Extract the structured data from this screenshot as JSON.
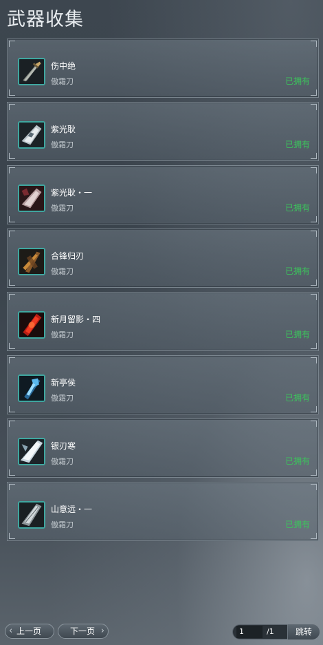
{
  "title": "武器收集",
  "items": [
    {
      "name": "伤中绝",
      "sub": "傲霜刀",
      "status": "已拥有",
      "icon": "dark-sword-icon"
    },
    {
      "name": "紫光耿",
      "sub": "傲霜刀",
      "status": "已拥有",
      "icon": "silver-blade-icon"
    },
    {
      "name": "紫光耿・一",
      "sub": "傲霜刀",
      "status": "已拥有",
      "icon": "red-silver-blade-icon"
    },
    {
      "name": "合锋归刃",
      "sub": "傲霜刀",
      "status": "已拥有",
      "icon": "bronze-blade-icon"
    },
    {
      "name": "新月留影・四",
      "sub": "傲霜刀",
      "status": "已拥有",
      "icon": "red-flame-blade-icon"
    },
    {
      "name": "新亭侯",
      "sub": "傲霜刀",
      "status": "已拥有",
      "icon": "blue-ice-blade-icon"
    },
    {
      "name": "银刃寒",
      "sub": "傲霜刀",
      "status": "已拥有",
      "icon": "frost-blade-icon"
    },
    {
      "name": "山意远・一",
      "sub": "傲霜刀",
      "status": "已拥有",
      "icon": "grey-blade-icon"
    }
  ],
  "pager": {
    "prev_label": "上一页",
    "next_label": "下一页",
    "current_page": "1",
    "total_pages": "/1",
    "jump_label": "跳转"
  },
  "colors": {
    "owned": "#3cc45c",
    "icon_border": "#3fa7a0"
  }
}
